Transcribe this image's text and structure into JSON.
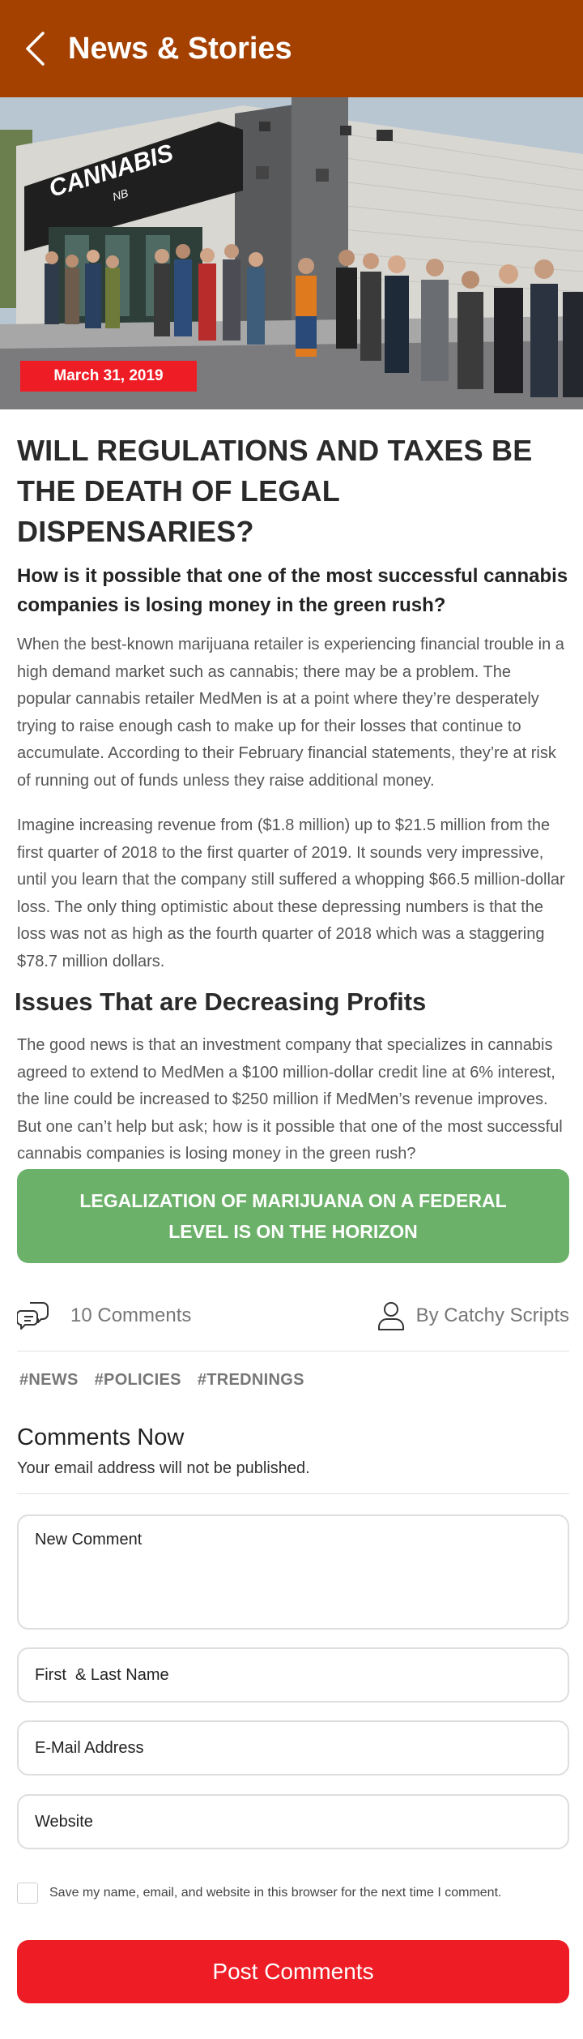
{
  "header": {
    "title": "News & Stories",
    "back_icon": "chevron-left-icon",
    "background_color": "#a54100"
  },
  "hero": {
    "image_description_icon": "storefront-photo",
    "store_sign": "CANNABIS",
    "store_sign_sub": "NB",
    "date": "March 31, 2019",
    "date_badge_color": "#ee1c25"
  },
  "article": {
    "headline": "WILL REGULATIONS AND TAXES BE THE DEATH OF LEGAL DISPENSARIES?",
    "subheadline": "How is it possible that one of the most successful cannabis companies is losing money in the green rush?",
    "paragraphs": [
      "When the best-known marijuana retailer is experiencing financial trouble in a high demand market such as cannabis; there may be a problem. The popular cannabis retailer MedMen is at a point where they’re desperately trying to raise enough cash to make up for their losses that continue to accumulate. According to their February financial statements, they’re at risk of running out of funds unless they raise additional money.",
      "Imagine increasing revenue from ($1.8 million) up to $21.5 million from the first quarter of 2018 to the first quarter of 2019. It sounds very impressive, until you learn that the company still suffered a whopping $66.5 million-dollar loss. The only thing optimistic about these depressing numbers is that the loss was not as high as the fourth quarter of 2018 which was a staggering $78.7 million dollars."
    ],
    "section_title": "Issues That are Decreasing Profits",
    "section_paragraph": "The good news is that an investment company that specializes in cannabis agreed to extend to MedMen a $100 million-dollar credit line at 6% interest, the line could be increased to $250 million if MedMen’s revenue improves. But one can’t help but ask; how is it possible that one of the most successful cannabis companies is losing money in the green rush?"
  },
  "cta": {
    "label": "LEGALIZATION OF MARIJUANA ON A FEDERAL LEVEL IS ON THE HORIZON",
    "color": "#6cb169"
  },
  "meta": {
    "comments_icon": "chat-bubbles-icon",
    "comments_count": "10 Comments",
    "author_icon": "user-icon",
    "author": "By Catchy Scripts"
  },
  "tags": [
    "#NEWS",
    "#POLICIES",
    "#TREDNINGS"
  ],
  "comment_form": {
    "title": "Comments Now",
    "note": "Your email address will not be published.",
    "comment_placeholder": "New Comment",
    "name_placeholder": "First  & Last Name",
    "email_placeholder": "E-Mail Address",
    "website_placeholder": "Website",
    "save_label": "Save my name, email, and website in this browser for the next time I comment.",
    "submit_label": "Post Comments",
    "submit_color": "#ee1c25"
  }
}
